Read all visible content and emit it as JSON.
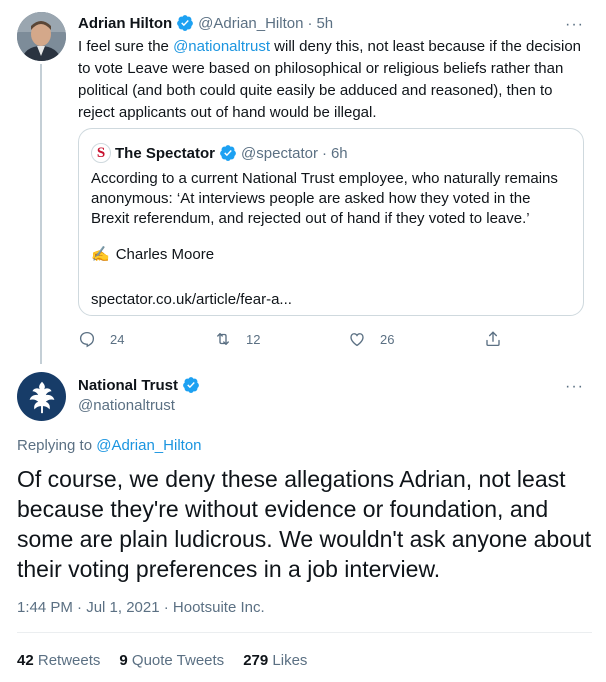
{
  "parent_tweet": {
    "display_name": "Adrian Hilton",
    "handle": "@Adrian_Hilton",
    "separator": "·",
    "time": "5h",
    "text_before": "I feel sure the ",
    "mention": "@nationaltrust",
    "text_after": " will deny this, not least because if the decision to vote Leave were based on philosophical or religious beliefs rather than political (and both could quite easily be adduced and reasoned), then to reject applicants out of hand would be illegal.",
    "quoted": {
      "display_name": "The Spectator",
      "handle": "@spectator",
      "separator": "·",
      "time": "6h",
      "logo_letter": "S",
      "text": "According to a current National Trust employee, who naturally remains anonymous: ‘At interviews people are asked how they voted in the Brexit referendum, and rejected out of hand if they voted to leave.’",
      "author_emoji": "✍️",
      "author": "Charles Moore",
      "link": "spectator.co.uk/article/fear-a..."
    },
    "actions": {
      "replies": "24",
      "retweets": "12",
      "likes": "26"
    }
  },
  "main_tweet": {
    "display_name": "National Trust",
    "handle": "@nationaltrust",
    "replying_label": "Replying to ",
    "replying_handle": "@Adrian_Hilton",
    "text": "Of course, we deny these allegations Adrian, not least because they're without evidence or foundation, and some are plain ludicrous. We wouldn't ask anyone about their voting preferences in a job interview.",
    "meta": "1:44 PM · Jul 1, 2021 · Hootsuite Inc.",
    "stats": {
      "retweets_count": "42",
      "retweets_label": "Retweets",
      "quotes_count": "9",
      "quotes_label": "Quote Tweets",
      "likes_count": "279",
      "likes_label": "Likes"
    }
  },
  "more_icon": "···",
  "colors": {
    "accent": "#1b95e0",
    "secondary_text": "#5b7083",
    "verified": "#1da1f2",
    "nt_avatar": "#173c68"
  }
}
